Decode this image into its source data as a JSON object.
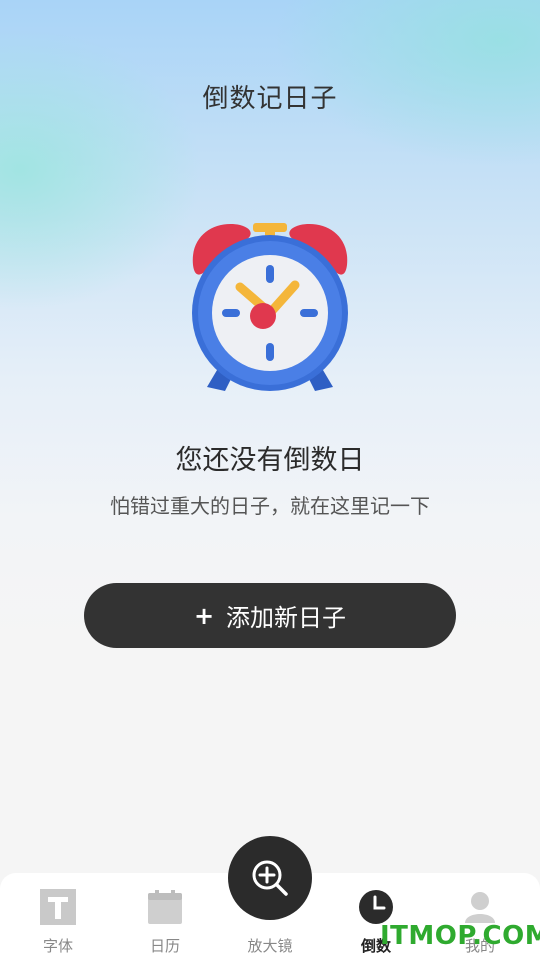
{
  "header": {
    "title": "倒数记日子"
  },
  "empty_state": {
    "illustration": "alarm-clock-icon",
    "title": "您还没有倒数日",
    "subtitle": "怕错过重大的日子，就在这里记一下"
  },
  "add_button": {
    "icon": "plus-icon",
    "label": "添加新日子"
  },
  "tabbar": {
    "tabs": [
      {
        "label": "字体",
        "icon": "font-icon",
        "active": false
      },
      {
        "label": "日历",
        "icon": "calendar-icon",
        "active": false
      },
      {
        "label": "放大镜",
        "icon": "magnifier-icon",
        "active": false
      },
      {
        "label": "倒数",
        "icon": "clock-icon",
        "active": true
      },
      {
        "label": "我的",
        "icon": "user-icon",
        "active": false
      }
    ]
  },
  "watermark": "ITMOP.COM",
  "colors": {
    "accent": "#333333",
    "watermark": "#2faa2f"
  }
}
